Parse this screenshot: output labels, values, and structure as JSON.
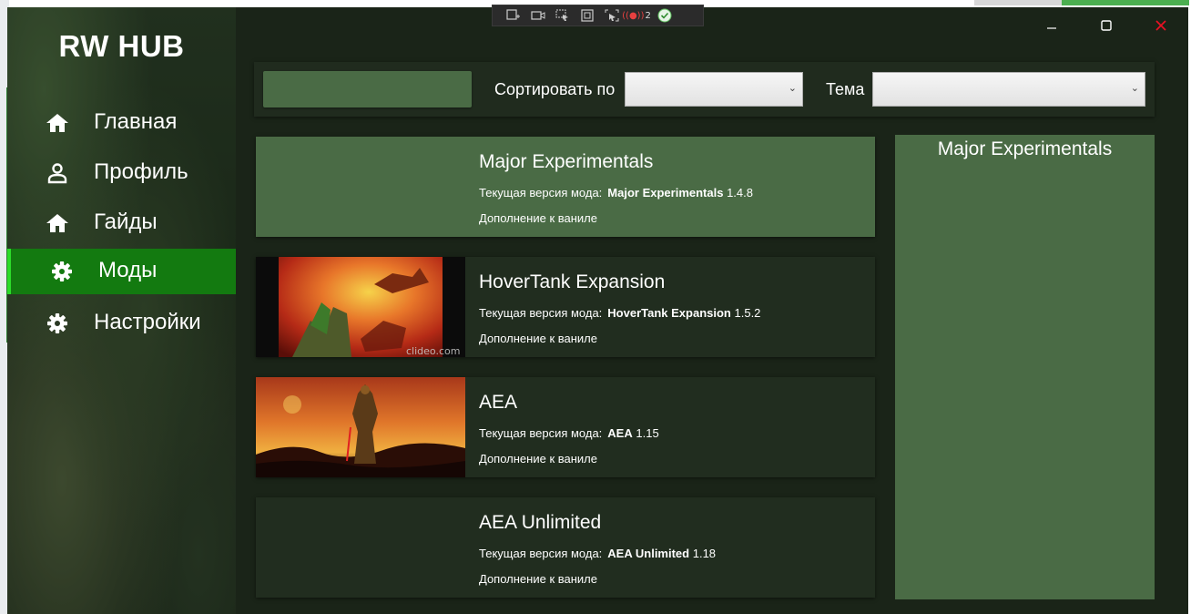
{
  "app": {
    "title": "RW HUB"
  },
  "sidebar": {
    "items": [
      {
        "label": "Главная",
        "icon": "home-icon",
        "active": false
      },
      {
        "label": "Профиль",
        "icon": "user-icon",
        "active": false
      },
      {
        "label": "Гайды",
        "icon": "home-icon",
        "active": false
      },
      {
        "label": "Моды",
        "icon": "gear-icon",
        "active": true
      },
      {
        "label": "Настройки",
        "icon": "gear-icon",
        "active": false
      }
    ]
  },
  "filters": {
    "search_value": "",
    "sort_label": "Сортировать по",
    "sort_value": "",
    "theme_label": "Тема",
    "theme_value": ""
  },
  "mods": [
    {
      "title": "Major Experimentals",
      "version_label": "Текущая версия мода:",
      "version_name": "Major Experimentals",
      "version_number": "1.4.8",
      "type": "Дополнение к ваниле",
      "selected": true,
      "has_image": false
    },
    {
      "title": "HoverTank Expansion",
      "version_label": "Текущая версия мода:",
      "version_name": "HoverTank Expansion",
      "version_number": "1.5.2",
      "type": "Дополнение к ваниле",
      "selected": false,
      "has_image": true,
      "image_watermark": "clideo.com"
    },
    {
      "title": "AEA",
      "version_label": "Текущая версия мода:",
      "version_name": "AEA",
      "version_number": "1.15",
      "type": "Дополнение к ваниле",
      "selected": false,
      "has_image": true
    },
    {
      "title": "AEA Unlimited",
      "version_label": "Текущая версия мода:",
      "version_name": "AEA Unlimited",
      "version_number": "1.18",
      "type": "Дополнение к ваниле",
      "selected": false,
      "has_image": false
    }
  ],
  "detail": {
    "title": "Major Experimentals"
  },
  "recorder": {
    "badge_count": "2"
  },
  "colors": {
    "accent_green": "#137a10",
    "accent_bright": "#2bdc29",
    "card_bg": "#212d1f",
    "card_selected": "#4a6b45",
    "close_red": "#e81123"
  }
}
